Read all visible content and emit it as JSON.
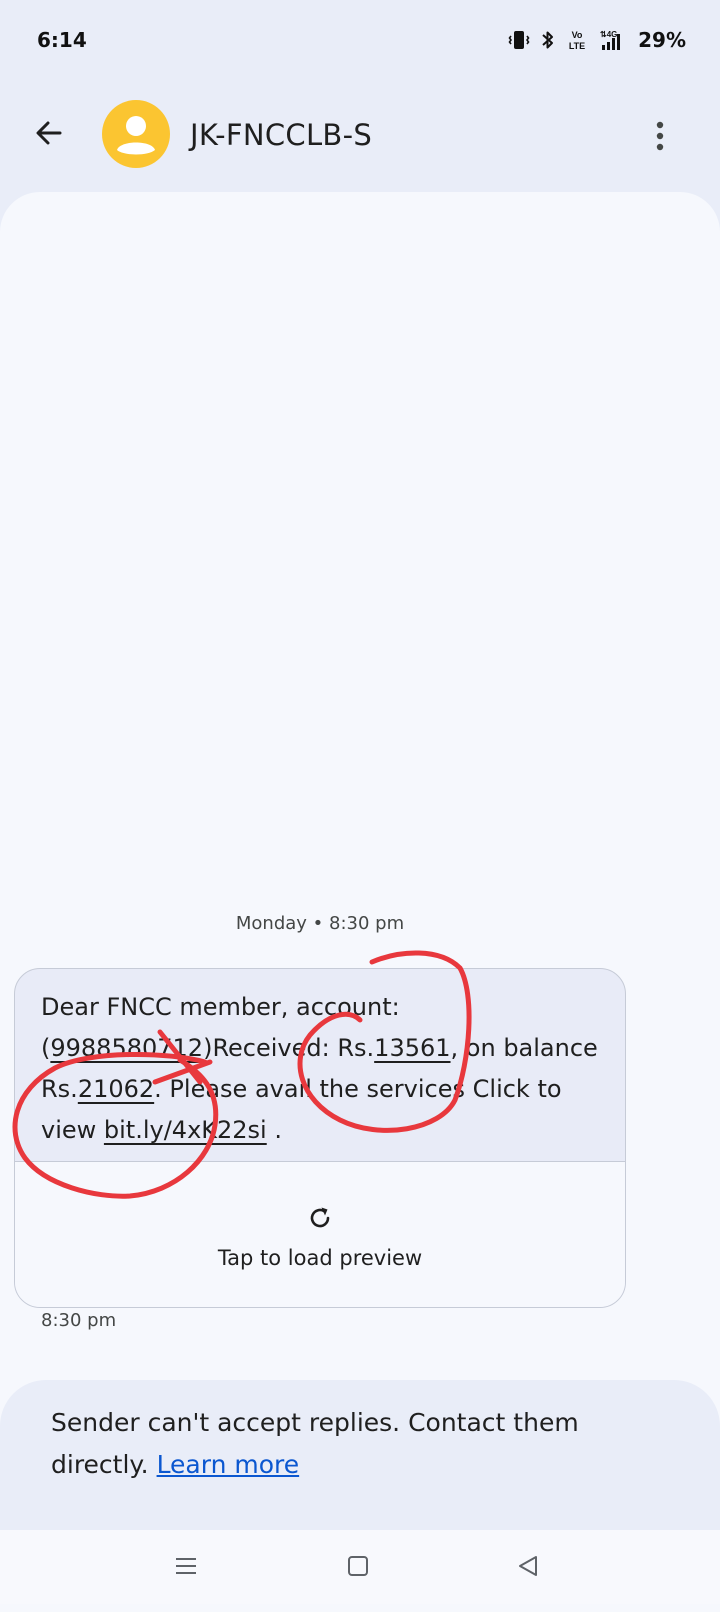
{
  "status_bar": {
    "time": "6:14",
    "battery": "29%",
    "icons": [
      "vibrate-icon",
      "bluetooth-icon",
      "volte-icon",
      "signal-4g-icon"
    ],
    "volte_label": "Vo\nLTE",
    "network_label": "4G"
  },
  "header": {
    "contact_name": "JK-FNCCLB-S",
    "avatar_color": "#fbc531",
    "icons": [
      "back-arrow-icon",
      "person-icon",
      "more-vert-icon"
    ]
  },
  "conversation": {
    "date_divider": "Monday • 8:30 pm",
    "message": {
      "segments": [
        {
          "text": "Dear FNCC member, account: (",
          "underline": false
        },
        {
          "text": "9988580712",
          "underline": true
        },
        {
          "text": ")Received: Rs.",
          "underline": false
        },
        {
          "text": "13561",
          "underline": true
        },
        {
          "text": ", on balance Rs.",
          "underline": false
        },
        {
          "text": "21062",
          "underline": true
        },
        {
          "text": ". Please avail the services Click to view ",
          "underline": false
        },
        {
          "text": "bit.ly/4xK22si",
          "underline": true
        },
        {
          "text": " .",
          "underline": false
        }
      ],
      "preview_label": "Tap to load preview",
      "preview_icon": "refresh-icon",
      "time": "8:30 pm"
    }
  },
  "reply_banner": {
    "text": "Sender can't accept replies. Contact them directly.",
    "link": "Learn more"
  },
  "nav_bar": {
    "icons": [
      "recents-icon",
      "home-icon",
      "back-triangle-icon"
    ]
  },
  "colors": {
    "background": "#e9edf8",
    "conversation_bg": "#f6f8fd",
    "bubble_bg": "#e8ebf7",
    "link": "#0b57d0",
    "annotation": "#e8383d"
  }
}
